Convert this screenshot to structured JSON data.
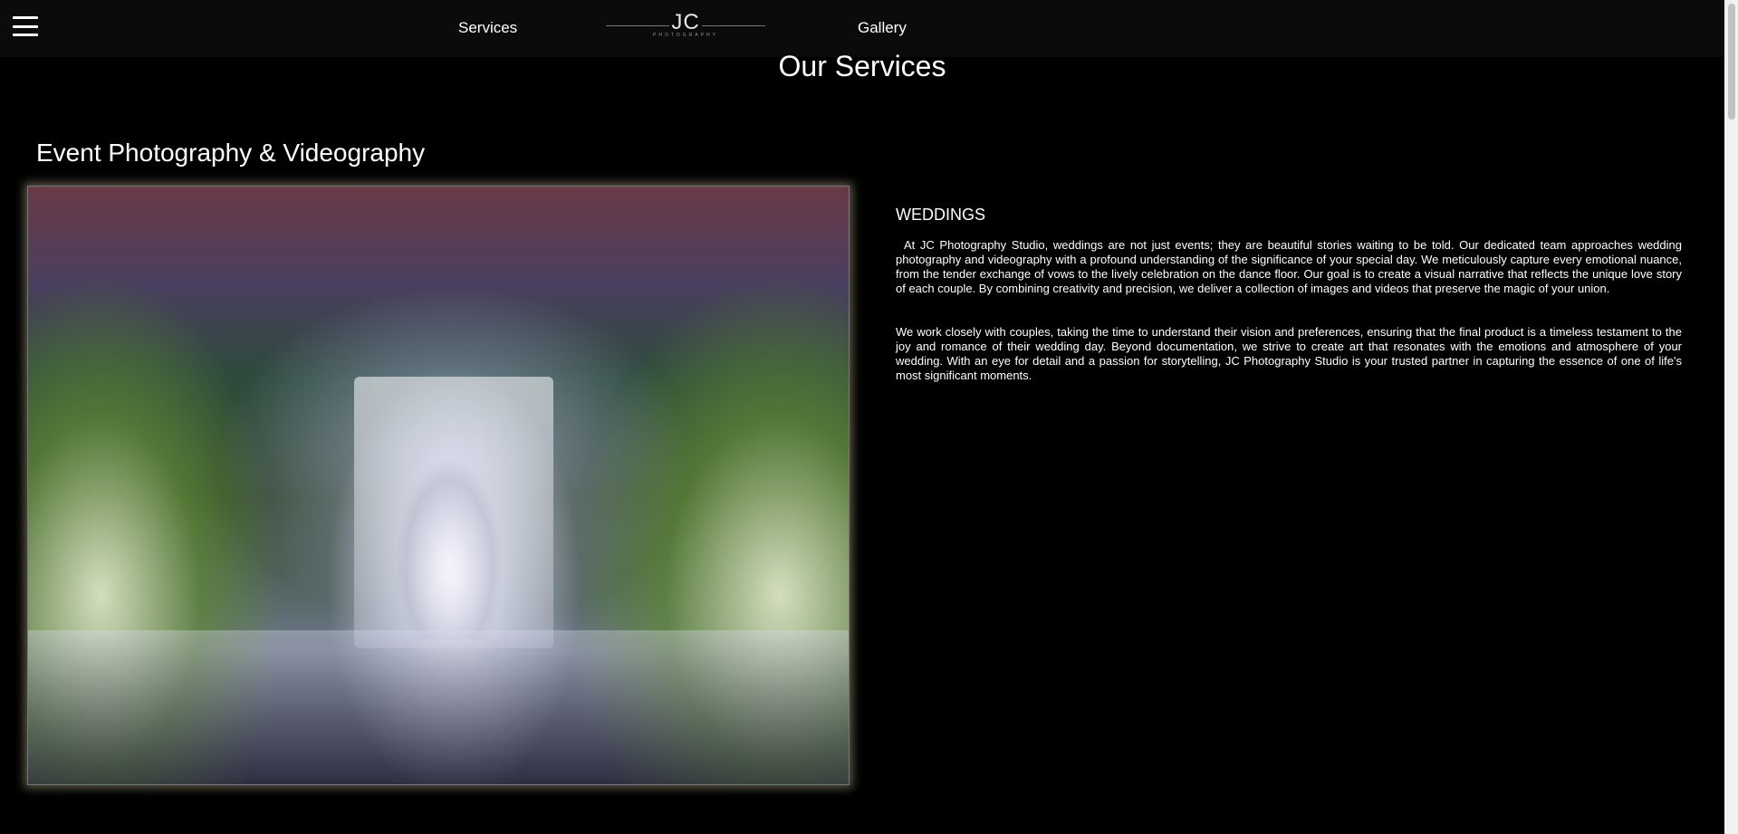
{
  "nav": {
    "menu_icon": "hamburger-menu-icon",
    "services_label": "Services",
    "gallery_label": "Gallery",
    "logo_text": "JC",
    "logo_subtext": "PHOTOGRAPHY"
  },
  "page": {
    "title": "Our Services"
  },
  "section": {
    "title": "Event Photography & Videography",
    "subheading": "WEDDINGS",
    "paragraph_1": "At JC Photography Studio, weddings are not just events; they are beautiful stories waiting to be told. Our dedicated team approaches wedding photography and videography with a profound understanding of the significance of your special day. We meticulously capture every emotional nuance, from the tender exchange of vows to the lively celebration on the dance floor. Our goal is to create a visual narrative that reflects the unique love story of each couple. By combining creativity and precision, we deliver a collection of images and videos that preserve the magic of your union.",
    "paragraph_2": "We work closely with couples, taking the time to understand their vision and preferences, ensuring that the final product is a timeless testament to the joy and romance of their wedding day. Beyond documentation, we strive to create art that resonates with the emotions and atmosphere of your wedding. With an eye for detail and a passion for storytelling, JC Photography Studio is your trusted partner in capturing the essence of one of life's most significant moments."
  }
}
